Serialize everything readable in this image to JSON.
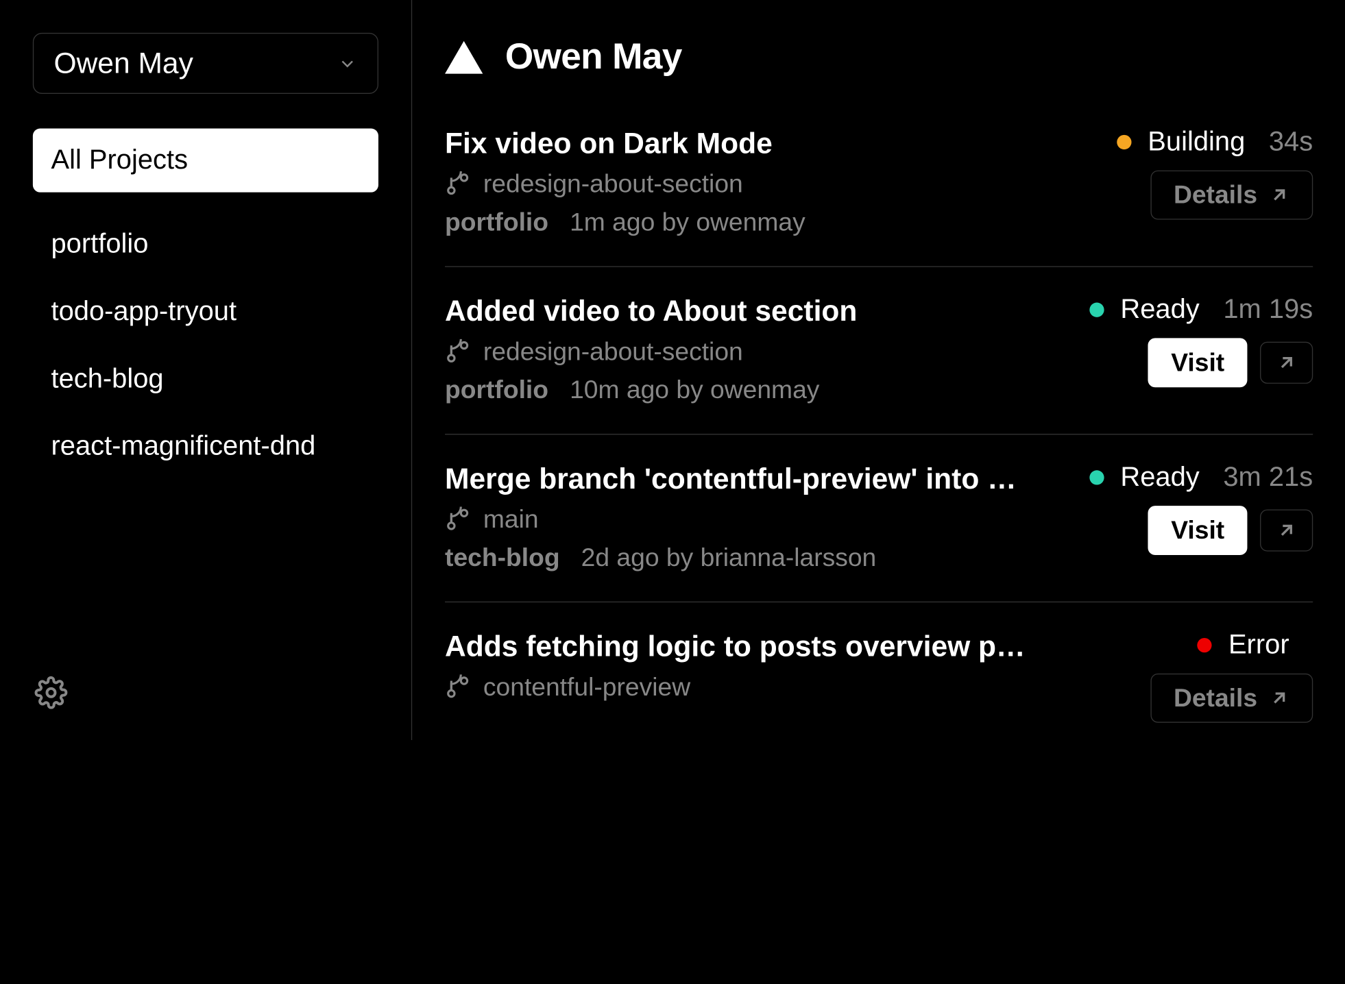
{
  "sidebar": {
    "account_name": "Owen May",
    "all_projects_label": "All Projects",
    "projects": [
      {
        "name": "portfolio"
      },
      {
        "name": "todo-app-tryout"
      },
      {
        "name": "tech-blog"
      },
      {
        "name": "react-magnificent-dnd"
      }
    ]
  },
  "header": {
    "title": "Owen May"
  },
  "labels": {
    "details": "Details",
    "visit": "Visit"
  },
  "deployments": [
    {
      "title": "Fix video on Dark Mode",
      "branch": "redesign-about-section",
      "project": "portfolio",
      "meta": "1m ago by owenmay",
      "status": "Building",
      "status_kind": "building",
      "duration": "34s",
      "action": "details"
    },
    {
      "title": "Added video to About section",
      "branch": "redesign-about-section",
      "project": "portfolio",
      "meta": "10m ago by owenmay",
      "status": "Ready",
      "status_kind": "ready",
      "duration": "1m 19s",
      "action": "visit"
    },
    {
      "title": "Merge branch 'contentful-preview' into m…",
      "branch": "main",
      "project": "tech-blog",
      "meta": "2d ago by brianna-larsson",
      "status": "Ready",
      "status_kind": "ready",
      "duration": "3m 21s",
      "action": "visit"
    },
    {
      "title": "Adds fetching logic to posts overview page",
      "branch": "contentful-preview",
      "project": "",
      "meta": "",
      "status": "Error",
      "status_kind": "error",
      "duration": "",
      "action": "details"
    }
  ]
}
